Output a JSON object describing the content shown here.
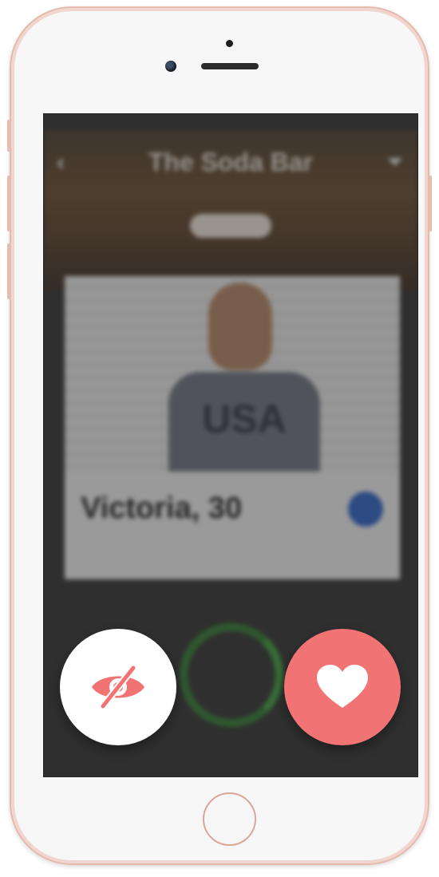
{
  "app": {
    "header_title": "The Soda Bar",
    "pill_label": "",
    "status": {
      "carrier": "",
      "time": "",
      "battery": ""
    }
  },
  "profile": {
    "name_age": "Victoria, 30",
    "occupation": "",
    "shirt_text": "USA"
  },
  "timer": {
    "text": ""
  },
  "actions": {
    "hide_label": "hide",
    "like_label": "like"
  },
  "colors": {
    "accent": "#f27373",
    "overlay": "#2f2f2f",
    "timer": "#3fa13f",
    "phone_frame": "#e6b9ad"
  }
}
